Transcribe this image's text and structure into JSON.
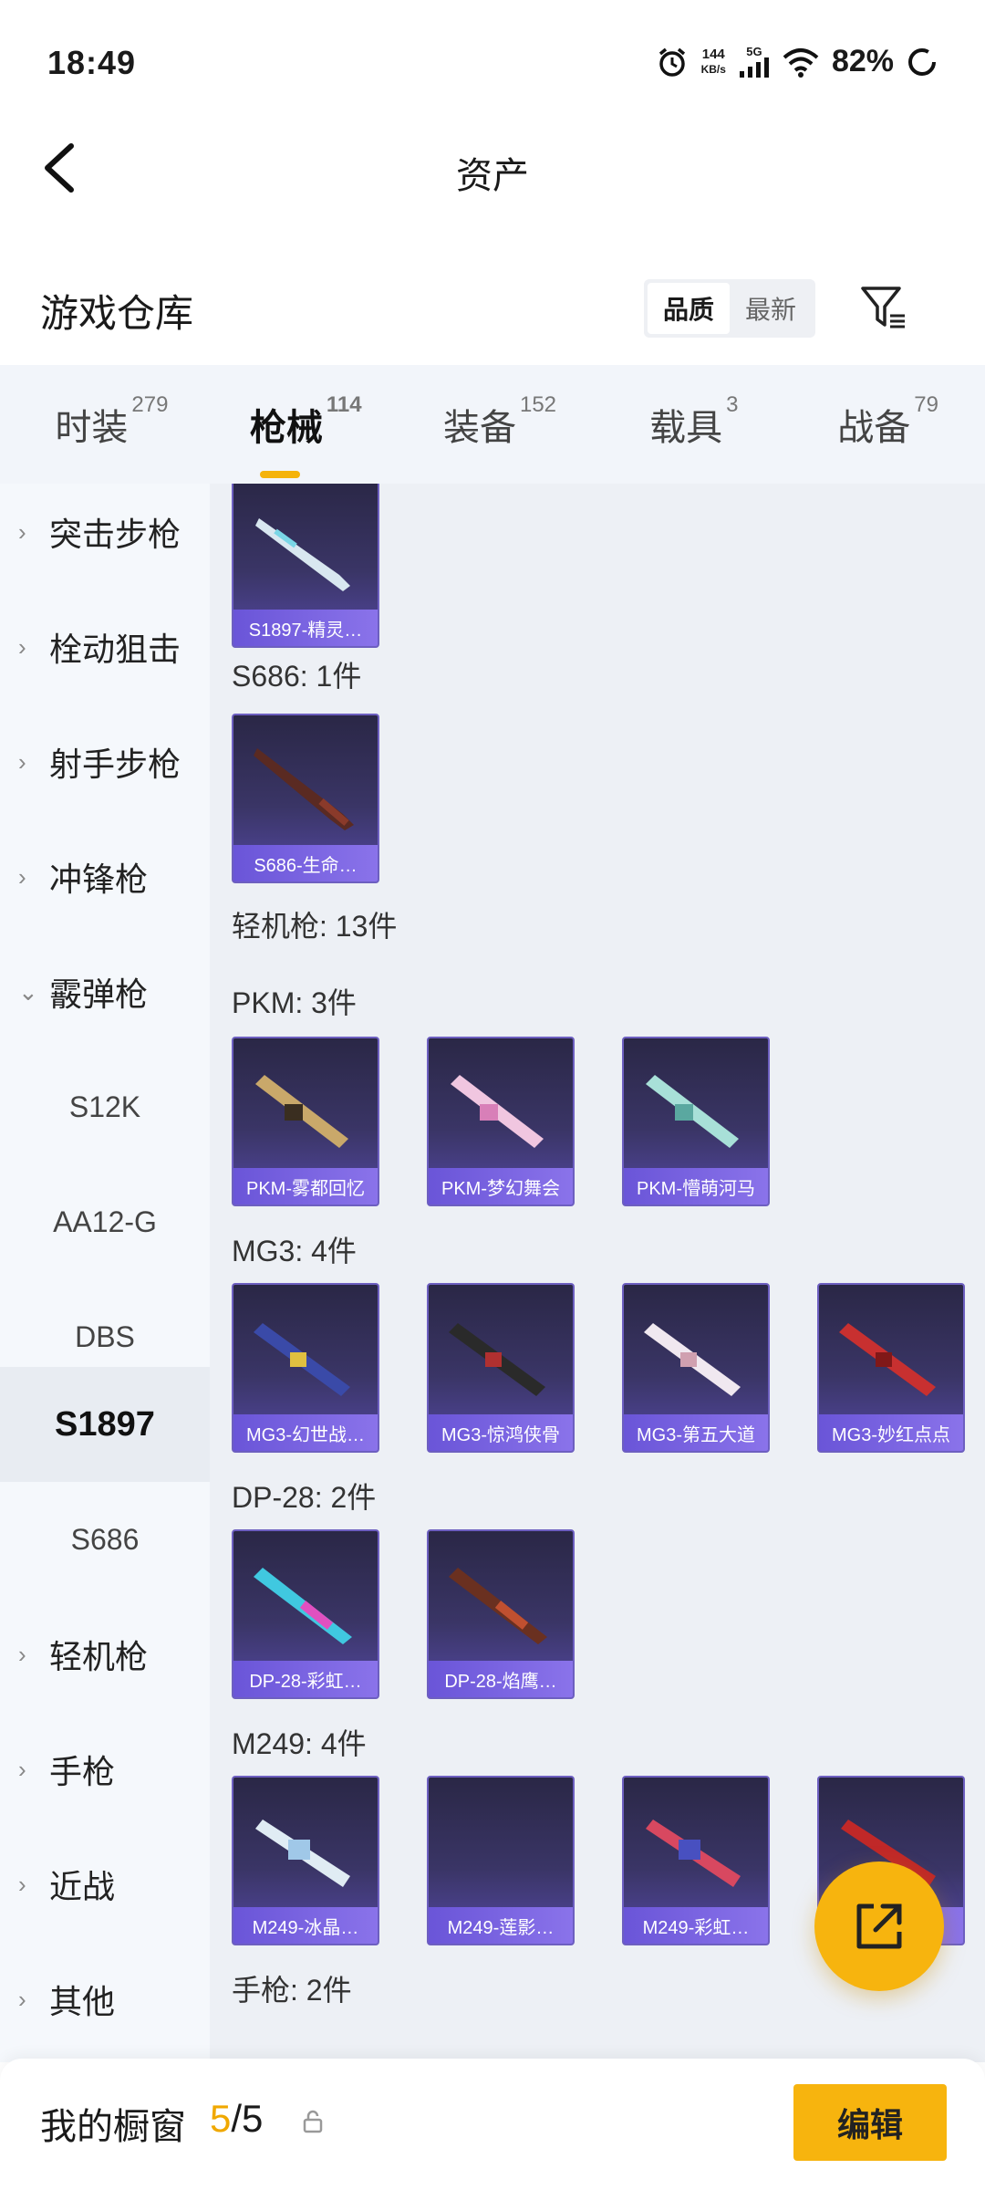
{
  "status_bar": {
    "time": "18:49",
    "speed_value": "144",
    "speed_unit": "KB/s",
    "network": "5G",
    "battery": "82%"
  },
  "header": {
    "title": "资产"
  },
  "warehouse": {
    "title": "游戏仓库",
    "sort_quality": "品质",
    "sort_newest": "最新"
  },
  "tabs": [
    {
      "label": "时装",
      "count": "279"
    },
    {
      "label": "枪械",
      "count": "114"
    },
    {
      "label": "装备",
      "count": "152"
    },
    {
      "label": "载具",
      "count": "3"
    },
    {
      "label": "战备",
      "count": "79"
    }
  ],
  "sidebar": {
    "categories": [
      "突击步枪",
      "栓动狙击",
      "射手步枪",
      "冲锋枪",
      "霰弹枪",
      "轻机枪",
      "手枪",
      "近战",
      "其他"
    ],
    "shotgun_subs": [
      "S12K",
      "AA12-G",
      "DBS",
      "S1897",
      "S686"
    ]
  },
  "content": {
    "groups": {
      "s686": "S686: 1件",
      "lmg": "轻机枪: 13件",
      "pkm": "PKM: 3件",
      "mg3": "MG3: 4件",
      "dp28": "DP-28: 2件",
      "m249": "M249: 4件",
      "pistol": "手枪: 2件"
    },
    "cards": {
      "s1897": [
        "S1897-精灵…"
      ],
      "s686": [
        "S686-生命…"
      ],
      "pkm": [
        "PKM-雾都回忆",
        "PKM-梦幻舞会",
        "PKM-懵萌河马"
      ],
      "mg3": [
        "MG3-幻世战…",
        "MG3-惊鸿侠骨",
        "MG3-第五大道",
        "MG3-妙红点点"
      ],
      "dp28": [
        "DP-28-彩虹…",
        "DP-28-焰鹰…"
      ],
      "m249": [
        "M249-冰晶…",
        "M249-莲影…",
        "M249-彩虹…",
        ""
      ]
    }
  },
  "bottom": {
    "label": "我的橱窗",
    "count_current": "5",
    "count_sep": "/",
    "count_total": "5",
    "edit": "编辑"
  },
  "colors": {
    "accent": "#f7b40e",
    "card_label": "#7a64e2"
  }
}
